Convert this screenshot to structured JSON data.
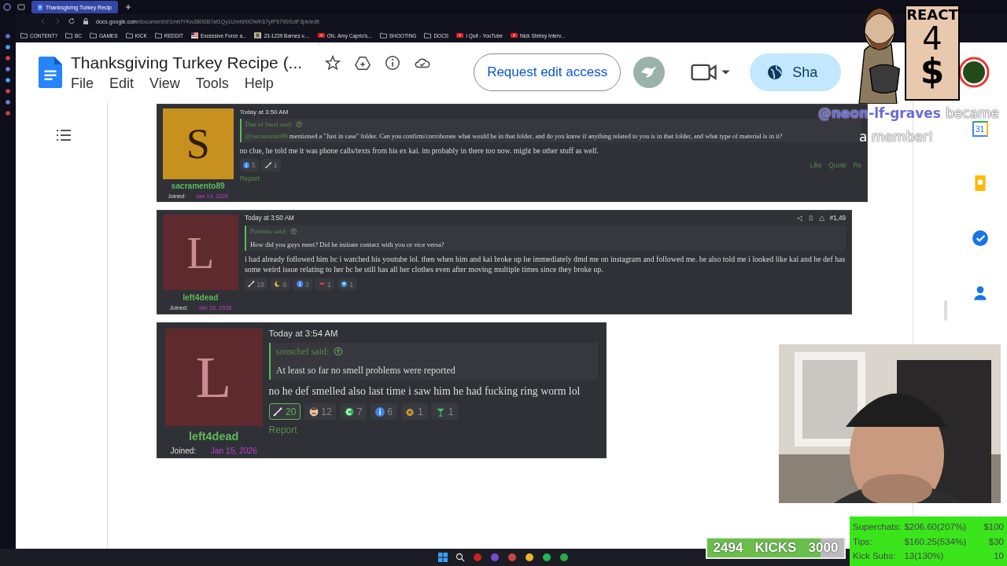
{
  "browser": {
    "tab_title": "Thanksgiving Turkey Recip",
    "url_host": "docs.google.com",
    "url_path": "/document/d/1mKfYKw380SB7af1Qy1UmfdXlOWK67yfP6790SctF3pk/edit",
    "bookmarks": [
      {
        "kind": "folder",
        "label": "CONTENT?"
      },
      {
        "kind": "folder",
        "label": "BC"
      },
      {
        "kind": "folder",
        "label": "GAMES"
      },
      {
        "kind": "folder",
        "label": "KICK"
      },
      {
        "kind": "folder",
        "label": "REDDIT"
      },
      {
        "kind": "flag",
        "label": "Excessive Force a..."
      },
      {
        "kind": "site",
        "label": "23-1239 Barnes v...."
      },
      {
        "kind": "video",
        "label": "Ofc. Amy Caprio's..."
      },
      {
        "kind": "folder",
        "label": "SHOOTING"
      },
      {
        "kind": "folder",
        "label": "DOCS"
      },
      {
        "kind": "video",
        "label": "I Quit - YouTube"
      },
      {
        "kind": "video",
        "label": "Nick Shirley Interv..."
      }
    ]
  },
  "document": {
    "title": "Thanksgiving Turkey Recipe (...",
    "menu": [
      "File",
      "Edit",
      "View",
      "Tools",
      "Help"
    ],
    "request_button": "Request edit access",
    "share_button": "Sha",
    "calendar_day": "31"
  },
  "posts": [
    {
      "initial": "S",
      "color": "#c8901e",
      "username": "sacramento89",
      "joined_label": "Joined:",
      "joined_date": "Jan 14, 2026",
      "time": "Today at 3:50 AM",
      "quote_author": "Dan of Steel said:",
      "quote_mention": "@sacramento89",
      "quote_text": "mentioned a \"Just in case\" folder. Can you confirm/corroborate what would be in that folder, and do you know if anything related to you is in that folder, and what type of material is in it?",
      "body": "no clue, he told me it was phone calls/texts from his ex kai. im probably in there too now. might be other stuff as well.",
      "reactions": [
        {
          "kind": "info",
          "count": "5",
          "selected": false
        },
        {
          "kind": "link",
          "count": "1",
          "selected": false
        }
      ],
      "report": "Report",
      "actions": [
        "Like",
        "Quote",
        "Re"
      ]
    },
    {
      "initial": "L",
      "color": "#5e2a2e",
      "username": "left4dead",
      "joined_label": "Joined:",
      "joined_date": "Jan 15, 2026",
      "time": "Today at 3:50 AM",
      "post_number": "#1,49",
      "quote_author": "Polentic said:",
      "quote_text": "How did you guys meet? Did he initiate contact with you or vice versa?",
      "body": "i had already followed him bc i watched his youtube lol. then when him and kai broke up he immediately dmd me on instagram and followed me. he also told me i looked like kai and he def has some weird issue relating to her bc he still has all her clothes even after moving multiple times since they broke up.",
      "reactions": [
        {
          "kind": "link",
          "count": "19",
          "selected": false
        },
        {
          "kind": "moon",
          "count": "6",
          "selected": false
        },
        {
          "kind": "info",
          "count": "3",
          "selected": false
        },
        {
          "kind": "lips",
          "count": "1",
          "selected": false
        },
        {
          "kind": "drop",
          "count": "1",
          "selected": false
        }
      ]
    },
    {
      "initial": "L",
      "color": "#5e2a2e",
      "username": "left4dead",
      "joined_label": "Joined:",
      "joined_date": "Jan 15, 2026",
      "time": "Today at 3:54 AM",
      "quote_author": "souschef said:",
      "quote_text": "At least so far no smell problems were reported",
      "body": "no he def smelled also last time i saw him he had fucking ring worm lol",
      "reactions": [
        {
          "kind": "link",
          "count": "20",
          "selected": true
        },
        {
          "kind": "face",
          "count": "12",
          "selected": false
        },
        {
          "kind": "badge",
          "count": "7",
          "selected": false
        },
        {
          "kind": "info",
          "count": "6",
          "selected": false
        },
        {
          "kind": "medal",
          "count": "1",
          "selected": false
        },
        {
          "kind": "glass",
          "count": "1",
          "selected": false
        }
      ],
      "report": "Report"
    }
  ],
  "stream": {
    "sticker_sign": [
      "REACT",
      "4",
      "$"
    ],
    "alert_user": "@neon-lf-graves",
    "alert_text": "became",
    "alert_text_2": "a member!",
    "kicks": {
      "current": "2494",
      "label": "KICKS",
      "goal": "3000",
      "level": 0.83
    },
    "goals": [
      {
        "label": "Superchats:",
        "value": "$206.60(207%)",
        "goal": "$100"
      },
      {
        "label": "Tips:",
        "value": "$160.25(534%)",
        "goal": "$30"
      },
      {
        "label": "Kick Subs:",
        "value": "13(130%)",
        "goal": "10"
      }
    ]
  }
}
